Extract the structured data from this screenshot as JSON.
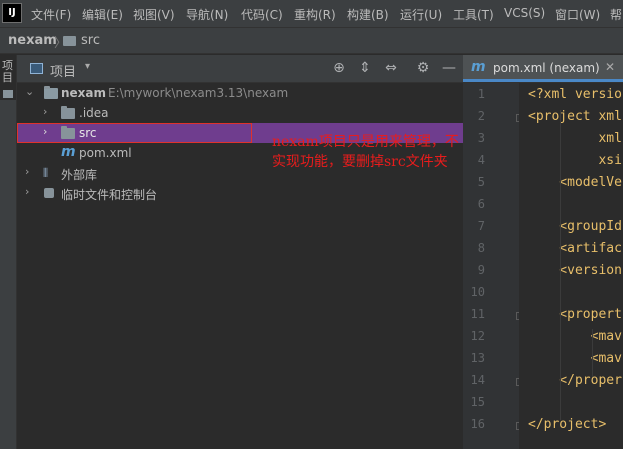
{
  "menubar": {
    "logo": "IJ",
    "items": [
      "文件(F)",
      "编辑(E)",
      "视图(V)",
      "导航(N)",
      "代码(C)",
      "重构(R)",
      "构建(B)",
      "运行(U)",
      "工具(T)",
      "VCS(S)",
      "窗口(W)",
      "帮"
    ]
  },
  "breadcrumb": {
    "project": "nexam",
    "separator": "〉",
    "folder": "src"
  },
  "toolstrip": {
    "label": "项目"
  },
  "project_panel": {
    "title": "项目",
    "dropdown": "▾",
    "buttons": [
      {
        "name": "locate-icon",
        "glyph": "⊕"
      },
      {
        "name": "expand-all-icon",
        "glyph": "⇕"
      },
      {
        "name": "collapse-all-icon",
        "glyph": "⇔"
      },
      {
        "name": "gear-icon",
        "glyph": "⚙"
      },
      {
        "name": "hide-icon",
        "glyph": "—"
      }
    ],
    "tree": {
      "root_name": "nexam",
      "root_path": "E:\\mywork\\nexam3.13\\nexam",
      "idea": ".idea",
      "src": "src",
      "pom": "pom.xml",
      "external_libs": "外部库",
      "scratches": "临时文件和控制台"
    }
  },
  "annotation": {
    "text": "nexam项目只是用来管理，不实现功能，要删掉src文件夹",
    "color": "#e81c1c"
  },
  "editor": {
    "tab_label": "pom.xml (nexam)",
    "tab_icon": "m",
    "line_numbers": [
      "1",
      "2",
      "3",
      "4",
      "5",
      "6",
      "7",
      "8",
      "9",
      "10",
      "11",
      "12",
      "13",
      "14",
      "15",
      "16"
    ],
    "lines": [
      "<?xml versio",
      "<project xml",
      "         xml",
      "         xsi",
      "    <modelVe",
      "",
      "    <groupId",
      "    <artifac",
      "    <version",
      "",
      "    <propert",
      "        <mav",
      "        <mav",
      "    </proper",
      "",
      "</project>"
    ]
  },
  "colors": {
    "selection": "#6f3d8e",
    "accent": "#4a88c7",
    "xml_tag": "#e8bf6a"
  }
}
